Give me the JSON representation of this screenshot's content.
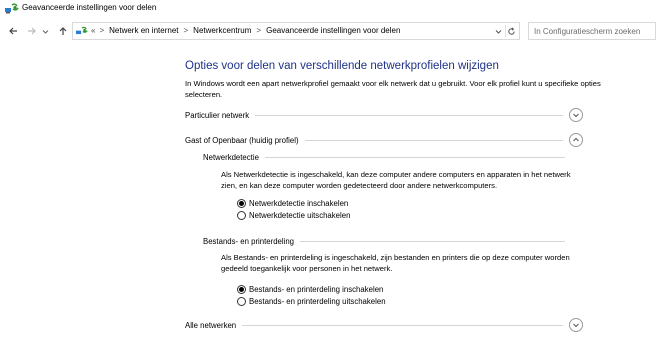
{
  "window": {
    "title": "Geavanceerde instellingen voor delen",
    "icon": "network-sharing-icon"
  },
  "nav": {
    "back_icon": "back-arrow-icon",
    "forward_icon": "forward-arrow-icon",
    "recent_icon": "chevron-down-icon",
    "up_icon": "up-arrow-icon"
  },
  "address": {
    "overflow": "«",
    "crumbs": [
      "Netwerk en internet",
      "Netwerkcentrum",
      "Geavanceerde instellingen voor delen"
    ],
    "separator": ">"
  },
  "search": {
    "placeholder": "In Configuratiescherm zoeken"
  },
  "content": {
    "heading": "Opties voor delen van verschillende netwerkprofielen wijzigen",
    "intro": "In Windows wordt een apart netwerkprofiel gemaakt voor elk netwerk dat u gebruikt. Voor elk profiel kunt u specifieke opties selecteren.",
    "profiles": {
      "private": {
        "label": "Particulier netwerk",
        "expanded": false
      },
      "guest": {
        "label": "Gast of Openbaar (huidig profiel)",
        "expanded": true
      },
      "all": {
        "label": "Alle netwerken",
        "expanded": false
      }
    },
    "network_discovery": {
      "title": "Netwerkdetectie",
      "description": "Als Netwerkdetectie is ingeschakeld, kan deze computer andere computers en apparaten in het netwerk zien, en kan deze computer worden gedetecteerd door andere netwerkcomputers.",
      "options": [
        {
          "label": "Netwerkdetectie inschakelen",
          "selected": true
        },
        {
          "label": "Netwerkdetectie uitschakelen",
          "selected": false
        }
      ]
    },
    "file_sharing": {
      "title": "Bestands- en printerdeling",
      "description": "Als Bestands- en printerdeling is ingeschakeld, zijn bestanden en printers die op deze computer worden gedeeld toegankelijk voor personen in het netwerk.",
      "options": [
        {
          "label": "Bestands- en printerdeling inschakelen",
          "selected": true
        },
        {
          "label": "Bestands- en printerdeling uitschakelen",
          "selected": false
        }
      ]
    }
  }
}
